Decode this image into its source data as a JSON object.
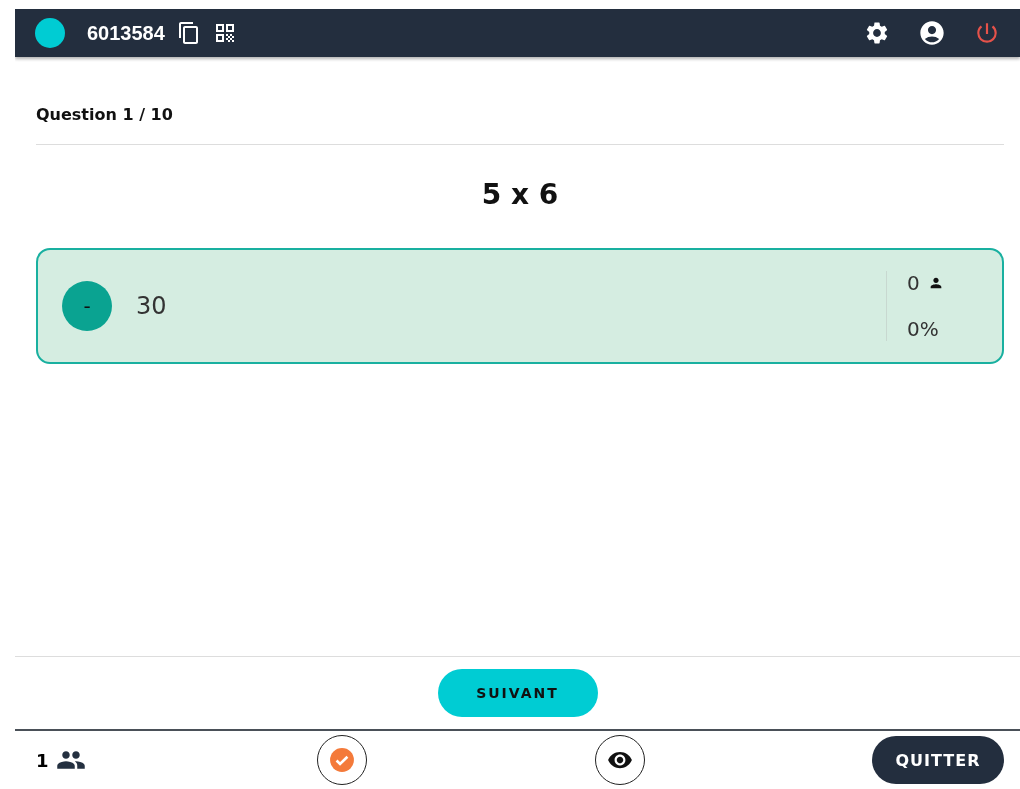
{
  "header": {
    "room_code": "6013584"
  },
  "question": {
    "counter": "Question 1 / 10",
    "text": "5 x 6"
  },
  "answers": [
    {
      "letter": "-",
      "text": "30",
      "correct": true,
      "votes": "0",
      "percent": "0%"
    }
  ],
  "next_button": "SUIVANT",
  "footer": {
    "participants": "1",
    "quit_button": "QUITTER"
  }
}
